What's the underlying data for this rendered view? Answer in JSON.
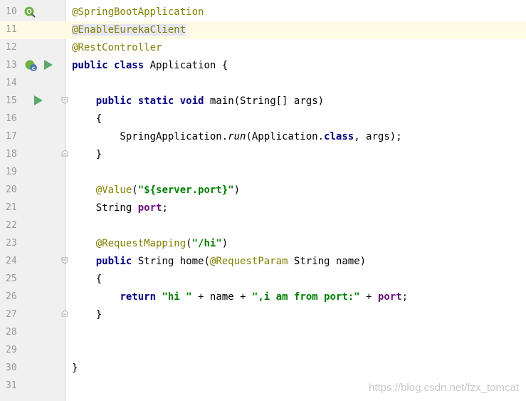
{
  "editor": {
    "lines": [
      {
        "num": "10",
        "tokens": [
          {
            "t": "@SpringBootApplication",
            "k": "annotation"
          }
        ]
      },
      {
        "num": "11",
        "highlight": true,
        "tokens": [
          {
            "t": "@EnableEurekaClient",
            "k": "annotation",
            "sel": true
          }
        ]
      },
      {
        "num": "12",
        "tokens": [
          {
            "t": "@RestController",
            "k": "annotation"
          }
        ]
      },
      {
        "num": "13",
        "tokens": [
          {
            "t": "public ",
            "k": "keyword"
          },
          {
            "t": "class ",
            "k": "keyword"
          },
          {
            "t": "Application {",
            "k": "plain"
          }
        ]
      },
      {
        "num": "14",
        "tokens": []
      },
      {
        "num": "15",
        "tokens": [
          {
            "t": "    ",
            "k": "plain"
          },
          {
            "t": "public ",
            "k": "keyword"
          },
          {
            "t": "static ",
            "k": "keyword"
          },
          {
            "t": "void ",
            "k": "keyword"
          },
          {
            "t": "main(String[] args)",
            "k": "plain"
          }
        ]
      },
      {
        "num": "16",
        "tokens": [
          {
            "t": "    {",
            "k": "plain"
          }
        ]
      },
      {
        "num": "17",
        "tokens": [
          {
            "t": "        SpringApplication.",
            "k": "plain"
          },
          {
            "t": "run",
            "k": "italic"
          },
          {
            "t": "(Application.",
            "k": "plain"
          },
          {
            "t": "class",
            "k": "keyword"
          },
          {
            "t": ", args);",
            "k": "plain"
          }
        ]
      },
      {
        "num": "18",
        "tokens": [
          {
            "t": "    }",
            "k": "plain"
          }
        ]
      },
      {
        "num": "19",
        "tokens": []
      },
      {
        "num": "20",
        "tokens": [
          {
            "t": "    ",
            "k": "plain"
          },
          {
            "t": "@Value",
            "k": "annotation"
          },
          {
            "t": "(",
            "k": "plain"
          },
          {
            "t": "\"${server.port}\"",
            "k": "string"
          },
          {
            "t": ")",
            "k": "plain"
          }
        ]
      },
      {
        "num": "21",
        "tokens": [
          {
            "t": "    String ",
            "k": "plain"
          },
          {
            "t": "port",
            "k": "field"
          },
          {
            "t": ";",
            "k": "plain"
          }
        ]
      },
      {
        "num": "22",
        "tokens": []
      },
      {
        "num": "23",
        "tokens": [
          {
            "t": "    ",
            "k": "plain"
          },
          {
            "t": "@RequestMapping",
            "k": "annotation"
          },
          {
            "t": "(",
            "k": "plain"
          },
          {
            "t": "\"/hi\"",
            "k": "string"
          },
          {
            "t": ")",
            "k": "plain"
          }
        ]
      },
      {
        "num": "24",
        "tokens": [
          {
            "t": "    ",
            "k": "plain"
          },
          {
            "t": "public ",
            "k": "keyword"
          },
          {
            "t": "String home(",
            "k": "plain"
          },
          {
            "t": "@RequestParam ",
            "k": "annotation"
          },
          {
            "t": "String name)",
            "k": "plain"
          }
        ]
      },
      {
        "num": "25",
        "tokens": [
          {
            "t": "    {",
            "k": "plain"
          }
        ]
      },
      {
        "num": "26",
        "tokens": [
          {
            "t": "        ",
            "k": "plain"
          },
          {
            "t": "return ",
            "k": "keyword"
          },
          {
            "t": "\"hi \" ",
            "k": "string"
          },
          {
            "t": "+ name + ",
            "k": "plain"
          },
          {
            "t": "\",i am from port:\" ",
            "k": "string"
          },
          {
            "t": "+ ",
            "k": "plain"
          },
          {
            "t": "port",
            "k": "field"
          },
          {
            "t": ";",
            "k": "plain"
          }
        ]
      },
      {
        "num": "27",
        "tokens": [
          {
            "t": "    }",
            "k": "plain"
          }
        ]
      },
      {
        "num": "28",
        "tokens": []
      },
      {
        "num": "29",
        "tokens": []
      },
      {
        "num": "30",
        "tokens": [
          {
            "t": "}",
            "k": "plain"
          }
        ]
      },
      {
        "num": "31",
        "tokens": []
      }
    ]
  },
  "gutter_icons": [
    {
      "line": "10",
      "name": "spring-boot-config-icon"
    },
    {
      "line": "13",
      "name": "spring-bean-icon"
    },
    {
      "line": "13",
      "name": "run-class-icon"
    },
    {
      "line": "15",
      "name": "run-main-icon"
    }
  ],
  "colors": {
    "annotation": "#808000",
    "keyword": "#000080",
    "string": "#008000",
    "field": "#660e7a",
    "gutter": "#f0f0f0",
    "line_number": "#999999",
    "current_line": "#fffae3",
    "run_icon": "#59a869"
  },
  "watermark": "https://blog.csdn.net/fzx_tomcat"
}
